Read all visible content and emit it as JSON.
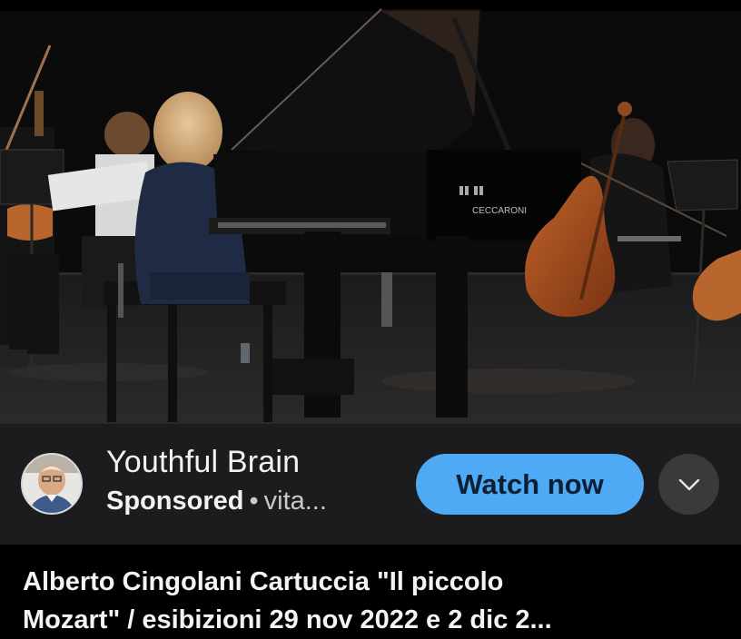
{
  "video": {
    "piano_brand": "CECCARONI"
  },
  "ad": {
    "advertiser_name": "Youthful Brain",
    "sponsored_label": "Sponsored",
    "separator": "•",
    "domain_truncated": "vita...",
    "cta_label": "Watch now",
    "cta_color": "#4eaaf5",
    "more_options_icon": "chevron-down-icon"
  },
  "post": {
    "title_line_1": "Alberto Cingolani Cartuccia \"Il piccolo",
    "title_line_2": "Mozart\" / esibizioni  29 nov 2022 e 2 dic 2..."
  }
}
